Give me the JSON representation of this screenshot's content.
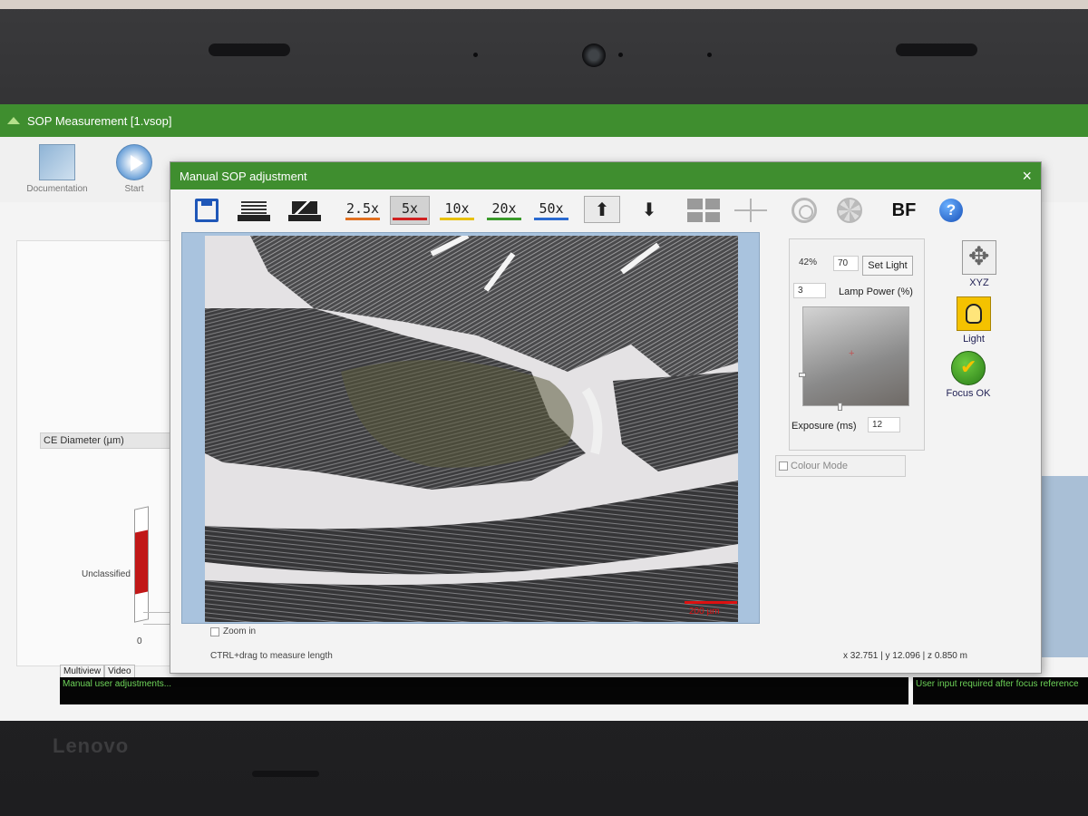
{
  "app": {
    "title": "SOP Measurement [1.vsop]",
    "brand": "Lenovo"
  },
  "main_toolbar": {
    "documentation_label": "Documentation",
    "start_label": "Start"
  },
  "left_panel": {
    "chart_header": "CE Diameter (µm)",
    "category_label": "Unclassified",
    "axis_zero": "0"
  },
  "bottom_tabs": [
    "Multiview",
    "Video"
  ],
  "status": {
    "left": "Manual user adjustments...",
    "right": "User input required after focus reference"
  },
  "dialog": {
    "title": "Manual SOP adjustment",
    "close_glyph": "×",
    "zoom_levels": [
      {
        "label": "2.5x",
        "color": "#e07020"
      },
      {
        "label": "5x",
        "color": "#d02020",
        "active": true
      },
      {
        "label": "10x",
        "color": "#e8c000"
      },
      {
        "label": "20x",
        "color": "#3a9a2a"
      },
      {
        "label": "50x",
        "color": "#2a6ad0"
      }
    ],
    "bf_label": "BF",
    "help_glyph": "?",
    "light_up_glyph": "⬆",
    "light_down_glyph": "⬇",
    "scale_bar_label": "200 µm",
    "zoom_in_label": "Zoom in",
    "hint": "CTRL+drag to measure length",
    "coords": "x 32.751 | y 12.096 | z 0.850 m"
  },
  "light_panel": {
    "percent": "42%",
    "set_value": "70",
    "set_light_label": "Set Light",
    "lamp_value": "3",
    "lamp_label": "Lamp Power (%)",
    "exposure_label": "Exposure (ms)",
    "exposure_value": "12",
    "crosshair_glyph": "+",
    "colour_mode_label": "Colour Mode"
  },
  "right_nav": {
    "xyz_label": "XYZ",
    "light_label": "Light",
    "focus_label": "Focus OK"
  },
  "colors": {
    "title_green": "#3f8e2f",
    "status_green": "#6fd65a",
    "accent_blue": "#1f57b8"
  }
}
